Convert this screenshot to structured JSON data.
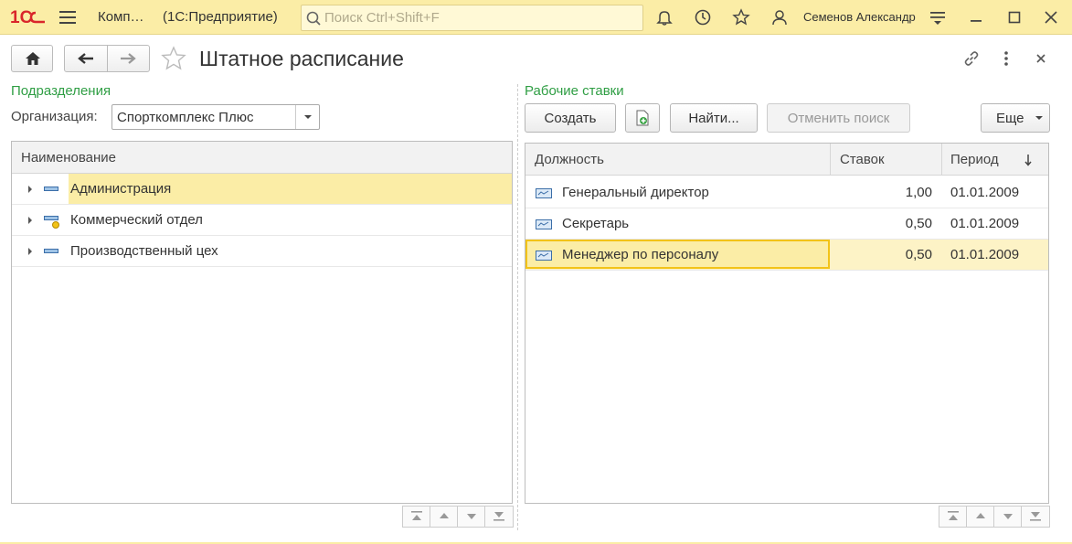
{
  "titlebar": {
    "app_short": "Комп…",
    "app_platform": "(1С:Предприятие)",
    "search_placeholder": "Поиск Ctrl+Shift+F",
    "user_name": "Семенов Александр"
  },
  "form": {
    "title": "Штатное расписание"
  },
  "left": {
    "section_title": "Подразделения",
    "org_label": "Организация:",
    "org_value": "Спорткомплекс Плюс",
    "column_header": "Наименование",
    "rows": [
      {
        "name": "Администрация",
        "selected": true
      },
      {
        "name": "Коммерческий отдел",
        "selected": false
      },
      {
        "name": "Производственный цех",
        "selected": false
      }
    ]
  },
  "right": {
    "section_title": "Рабочие ставки",
    "create_label": "Создать",
    "find_label": "Найти...",
    "cancel_search_label": "Отменить поиск",
    "more_label": "Еще",
    "columns": {
      "position": "Должность",
      "rate": "Ставок",
      "period": "Период"
    },
    "rows": [
      {
        "position": "Генеральный директор",
        "rate": "1,00",
        "period": "01.01.2009",
        "selected": false
      },
      {
        "position": "Секретарь",
        "rate": "0,50",
        "period": "01.01.2009",
        "selected": false
      },
      {
        "position": "Менеджер по персоналу",
        "rate": "0,50",
        "period": "01.01.2009",
        "selected": true
      }
    ]
  },
  "colors": {
    "titlebar_bg": "#fbeda6",
    "selection_bg": "#fbeda6",
    "section_green": "#2f9e44",
    "logo_red": "#d9262b"
  }
}
